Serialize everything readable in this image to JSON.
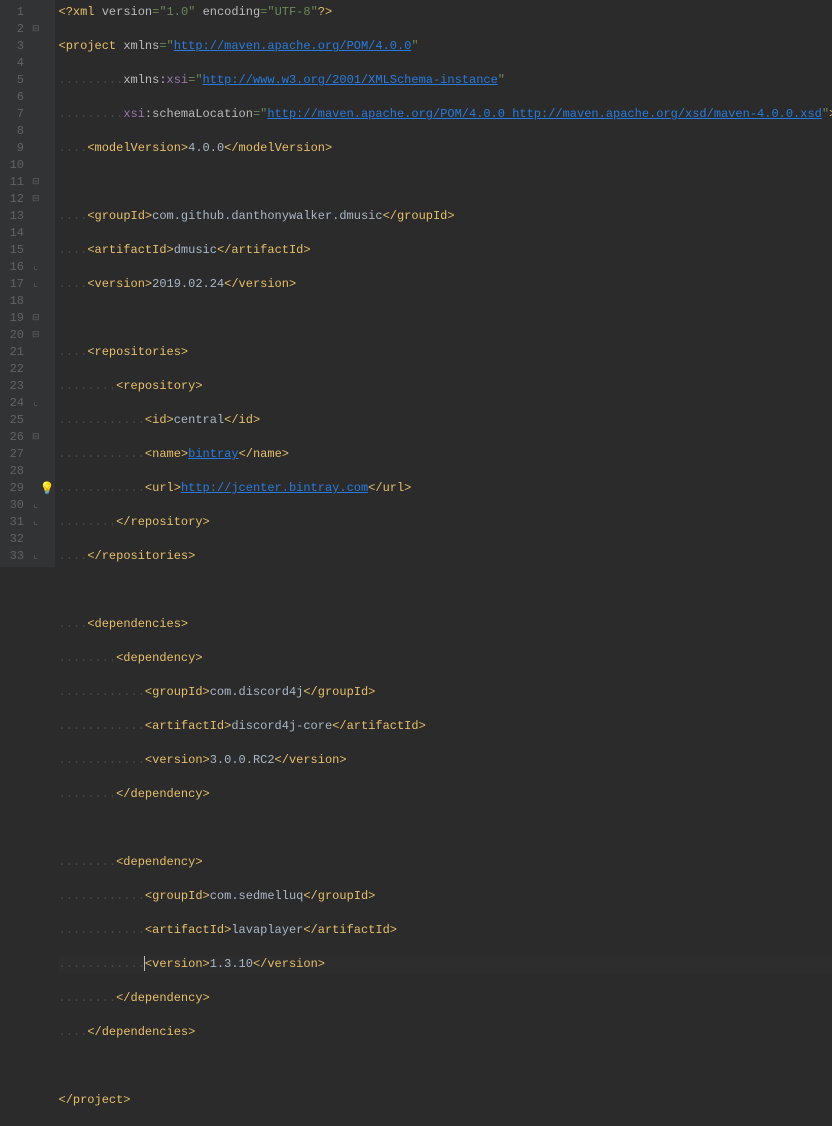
{
  "lines": [
    {
      "n": 1,
      "fold": "",
      "segs": [
        {
          "c": "pi",
          "t": "<?"
        },
        {
          "c": "tag",
          "t": "xml "
        },
        {
          "c": "attr",
          "t": "version"
        },
        {
          "c": "str",
          "t": "=\"1.0\" "
        },
        {
          "c": "attr",
          "t": "encoding"
        },
        {
          "c": "str",
          "t": "=\"UTF-8\""
        },
        {
          "c": "pi",
          "t": "?>"
        }
      ]
    },
    {
      "n": 2,
      "fold": "⊟",
      "segs": [
        {
          "c": "tag",
          "t": "<project "
        },
        {
          "c": "attr",
          "t": "xmlns"
        },
        {
          "c": "str",
          "t": "=\""
        },
        {
          "c": "link",
          "t": "http://maven.apache.org/POM/4.0.0"
        },
        {
          "c": "str",
          "t": "\""
        }
      ]
    },
    {
      "n": 3,
      "fold": "",
      "segs": [
        {
          "c": "ws",
          "t": "........."
        },
        {
          "c": "attr",
          "t": "xmlns"
        },
        {
          "c": "text",
          "t": ":"
        },
        {
          "c": "ns",
          "t": "xsi"
        },
        {
          "c": "str",
          "t": "=\""
        },
        {
          "c": "link",
          "t": "http://www.w3.org/2001/XMLSchema-instance"
        },
        {
          "c": "str",
          "t": "\""
        }
      ]
    },
    {
      "n": 4,
      "fold": "",
      "segs": [
        {
          "c": "ws",
          "t": "........."
        },
        {
          "c": "ns",
          "t": "xsi"
        },
        {
          "c": "attr",
          "t": ":schemaLocation"
        },
        {
          "c": "str",
          "t": "=\""
        },
        {
          "c": "link",
          "t": "http://maven.apache.org/POM/4.0.0 http://maven.apache.org/xsd/maven-4.0.0.xsd"
        },
        {
          "c": "str",
          "t": "\""
        },
        {
          "c": "tag",
          "t": ">"
        }
      ]
    },
    {
      "n": 5,
      "fold": "",
      "segs": [
        {
          "c": "ws",
          "t": "...."
        },
        {
          "c": "tag",
          "t": "<modelVersion>"
        },
        {
          "c": "text",
          "t": "4.0.0"
        },
        {
          "c": "tag",
          "t": "</modelVersion>"
        }
      ]
    },
    {
      "n": 6,
      "fold": "",
      "segs": []
    },
    {
      "n": 7,
      "fold": "",
      "segs": [
        {
          "c": "ws",
          "t": "...."
        },
        {
          "c": "tag",
          "t": "<groupId>"
        },
        {
          "c": "text",
          "t": "com.github.danthonywalker.dmusic"
        },
        {
          "c": "tag",
          "t": "</groupId>"
        }
      ]
    },
    {
      "n": 8,
      "fold": "",
      "segs": [
        {
          "c": "ws",
          "t": "...."
        },
        {
          "c": "tag",
          "t": "<artifactId>"
        },
        {
          "c": "text",
          "t": "dmusic"
        },
        {
          "c": "tag",
          "t": "</artifactId>"
        }
      ]
    },
    {
      "n": 9,
      "fold": "",
      "segs": [
        {
          "c": "ws",
          "t": "...."
        },
        {
          "c": "tag",
          "t": "<version>"
        },
        {
          "c": "text",
          "t": "2019.02.24"
        },
        {
          "c": "tag",
          "t": "</version>"
        }
      ]
    },
    {
      "n": 10,
      "fold": "",
      "segs": []
    },
    {
      "n": 11,
      "fold": "⊟",
      "segs": [
        {
          "c": "ws",
          "t": "...."
        },
        {
          "c": "tag",
          "t": "<repositories>"
        }
      ]
    },
    {
      "n": 12,
      "fold": "⊟",
      "segs": [
        {
          "c": "ws",
          "t": "........"
        },
        {
          "c": "tag",
          "t": "<repository>"
        }
      ]
    },
    {
      "n": 13,
      "fold": "",
      "segs": [
        {
          "c": "ws",
          "t": "............"
        },
        {
          "c": "tag",
          "t": "<id>"
        },
        {
          "c": "text",
          "t": "central"
        },
        {
          "c": "tag",
          "t": "</id>"
        }
      ]
    },
    {
      "n": 14,
      "fold": "",
      "segs": [
        {
          "c": "ws",
          "t": "............"
        },
        {
          "c": "tag",
          "t": "<name>"
        },
        {
          "c": "link",
          "t": "bintray"
        },
        {
          "c": "tag",
          "t": "</name>"
        }
      ]
    },
    {
      "n": 15,
      "fold": "",
      "segs": [
        {
          "c": "ws",
          "t": "............"
        },
        {
          "c": "tag",
          "t": "<url>"
        },
        {
          "c": "link",
          "t": "http://jcenter.bintray.com"
        },
        {
          "c": "tag",
          "t": "</url>"
        }
      ]
    },
    {
      "n": 16,
      "fold": "⊢",
      "segs": [
        {
          "c": "ws",
          "t": "........"
        },
        {
          "c": "tag",
          "t": "</repository>"
        }
      ]
    },
    {
      "n": 17,
      "fold": "⊢",
      "segs": [
        {
          "c": "ws",
          "t": "...."
        },
        {
          "c": "tag",
          "t": "</repositories>"
        }
      ]
    },
    {
      "n": 18,
      "fold": "",
      "segs": []
    },
    {
      "n": 19,
      "fold": "⊟",
      "segs": [
        {
          "c": "ws",
          "t": "...."
        },
        {
          "c": "tag",
          "t": "<dependencies>"
        }
      ]
    },
    {
      "n": 20,
      "fold": "⊟",
      "segs": [
        {
          "c": "ws",
          "t": "........"
        },
        {
          "c": "tag",
          "t": "<dependency>"
        }
      ]
    },
    {
      "n": 21,
      "fold": "",
      "segs": [
        {
          "c": "ws",
          "t": "............"
        },
        {
          "c": "tag",
          "t": "<groupId>"
        },
        {
          "c": "text",
          "t": "com.discord4j"
        },
        {
          "c": "tag",
          "t": "</groupId>"
        }
      ]
    },
    {
      "n": 22,
      "fold": "",
      "segs": [
        {
          "c": "ws",
          "t": "............"
        },
        {
          "c": "tag",
          "t": "<artifactId>"
        },
        {
          "c": "text",
          "t": "discord4j-core"
        },
        {
          "c": "tag",
          "t": "</artifactId>"
        }
      ]
    },
    {
      "n": 23,
      "fold": "",
      "segs": [
        {
          "c": "ws",
          "t": "............"
        },
        {
          "c": "tag",
          "t": "<version>"
        },
        {
          "c": "text",
          "t": "3.0.0.RC2"
        },
        {
          "c": "tag",
          "t": "</version>"
        }
      ]
    },
    {
      "n": 24,
      "fold": "⊢",
      "segs": [
        {
          "c": "ws",
          "t": "........"
        },
        {
          "c": "tag",
          "t": "</dependency>"
        }
      ]
    },
    {
      "n": 25,
      "fold": "",
      "segs": []
    },
    {
      "n": 26,
      "fold": "⊟",
      "segs": [
        {
          "c": "ws",
          "t": "........"
        },
        {
          "c": "tag",
          "t": "<dependency>"
        }
      ]
    },
    {
      "n": 27,
      "fold": "",
      "segs": [
        {
          "c": "ws",
          "t": "............"
        },
        {
          "c": "tag",
          "t": "<groupId>"
        },
        {
          "c": "text",
          "t": "com.sedmelluq"
        },
        {
          "c": "tag",
          "t": "</groupId>"
        }
      ]
    },
    {
      "n": 28,
      "fold": "",
      "segs": [
        {
          "c": "ws",
          "t": "............"
        },
        {
          "c": "tag",
          "t": "<artifactId>"
        },
        {
          "c": "text",
          "t": "lavaplayer"
        },
        {
          "c": "tag",
          "t": "</artifactId>"
        }
      ]
    },
    {
      "n": 29,
      "fold": "",
      "bulb": true,
      "current": true,
      "selected": true,
      "segs": [
        {
          "c": "ws",
          "t": "............"
        },
        {
          "c": "tag",
          "t": "<version>"
        },
        {
          "c": "text",
          "t": "1.3.10"
        },
        {
          "c": "tag",
          "t": "</version>"
        }
      ]
    },
    {
      "n": 30,
      "fold": "⊢",
      "segs": [
        {
          "c": "ws",
          "t": "........"
        },
        {
          "c": "tag",
          "t": "</dependency>"
        }
      ]
    },
    {
      "n": 31,
      "fold": "⊢",
      "segs": [
        {
          "c": "ws",
          "t": "...."
        },
        {
          "c": "tag",
          "t": "</dependencies>"
        }
      ]
    },
    {
      "n": 32,
      "fold": "",
      "segs": []
    },
    {
      "n": 33,
      "fold": "⊢",
      "segs": [
        {
          "c": "tag",
          "t": "</project>"
        }
      ]
    }
  ]
}
